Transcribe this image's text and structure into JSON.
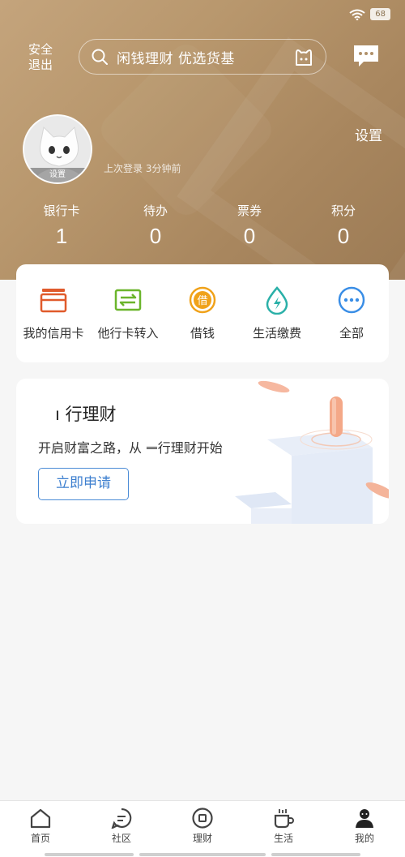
{
  "status": {
    "battery": "68"
  },
  "header": {
    "safe_exit": "安全退出",
    "search_placeholder": "闲钱理财 优选货基",
    "settings": "设置",
    "avatar_label": "设置",
    "last_login": "上次登录 3分钟前"
  },
  "stats": [
    {
      "label": "银行卡",
      "value": "1"
    },
    {
      "label": "待办",
      "value": "0"
    },
    {
      "label": "票券",
      "value": "0"
    },
    {
      "label": "积分",
      "value": "0"
    }
  ],
  "quick_actions": [
    {
      "label": "我的信用卡",
      "icon": "credit-card-icon",
      "color": "#e05a2b"
    },
    {
      "label": "他行卡转入",
      "icon": "card-transfer-icon",
      "color": "#6bb52c"
    },
    {
      "label": "借钱",
      "icon": "borrow-icon",
      "color": "#f0a21a"
    },
    {
      "label": "生活缴费",
      "icon": "water-drop-icon",
      "color": "#2ab0a8"
    },
    {
      "label": "全部",
      "icon": "more-icon",
      "color": "#3a8ee6"
    }
  ],
  "promo": {
    "title": "ı 行理财",
    "subtitle": "开启财富之路，从 ᆖ行理财开始",
    "button": "立即申请"
  },
  "tabbar": [
    {
      "label": "首页",
      "icon": "home-icon"
    },
    {
      "label": "社区",
      "icon": "community-icon"
    },
    {
      "label": "理财",
      "icon": "finance-icon"
    },
    {
      "label": "生活",
      "icon": "cup-icon"
    },
    {
      "label": "我的",
      "icon": "profile-icon"
    }
  ]
}
